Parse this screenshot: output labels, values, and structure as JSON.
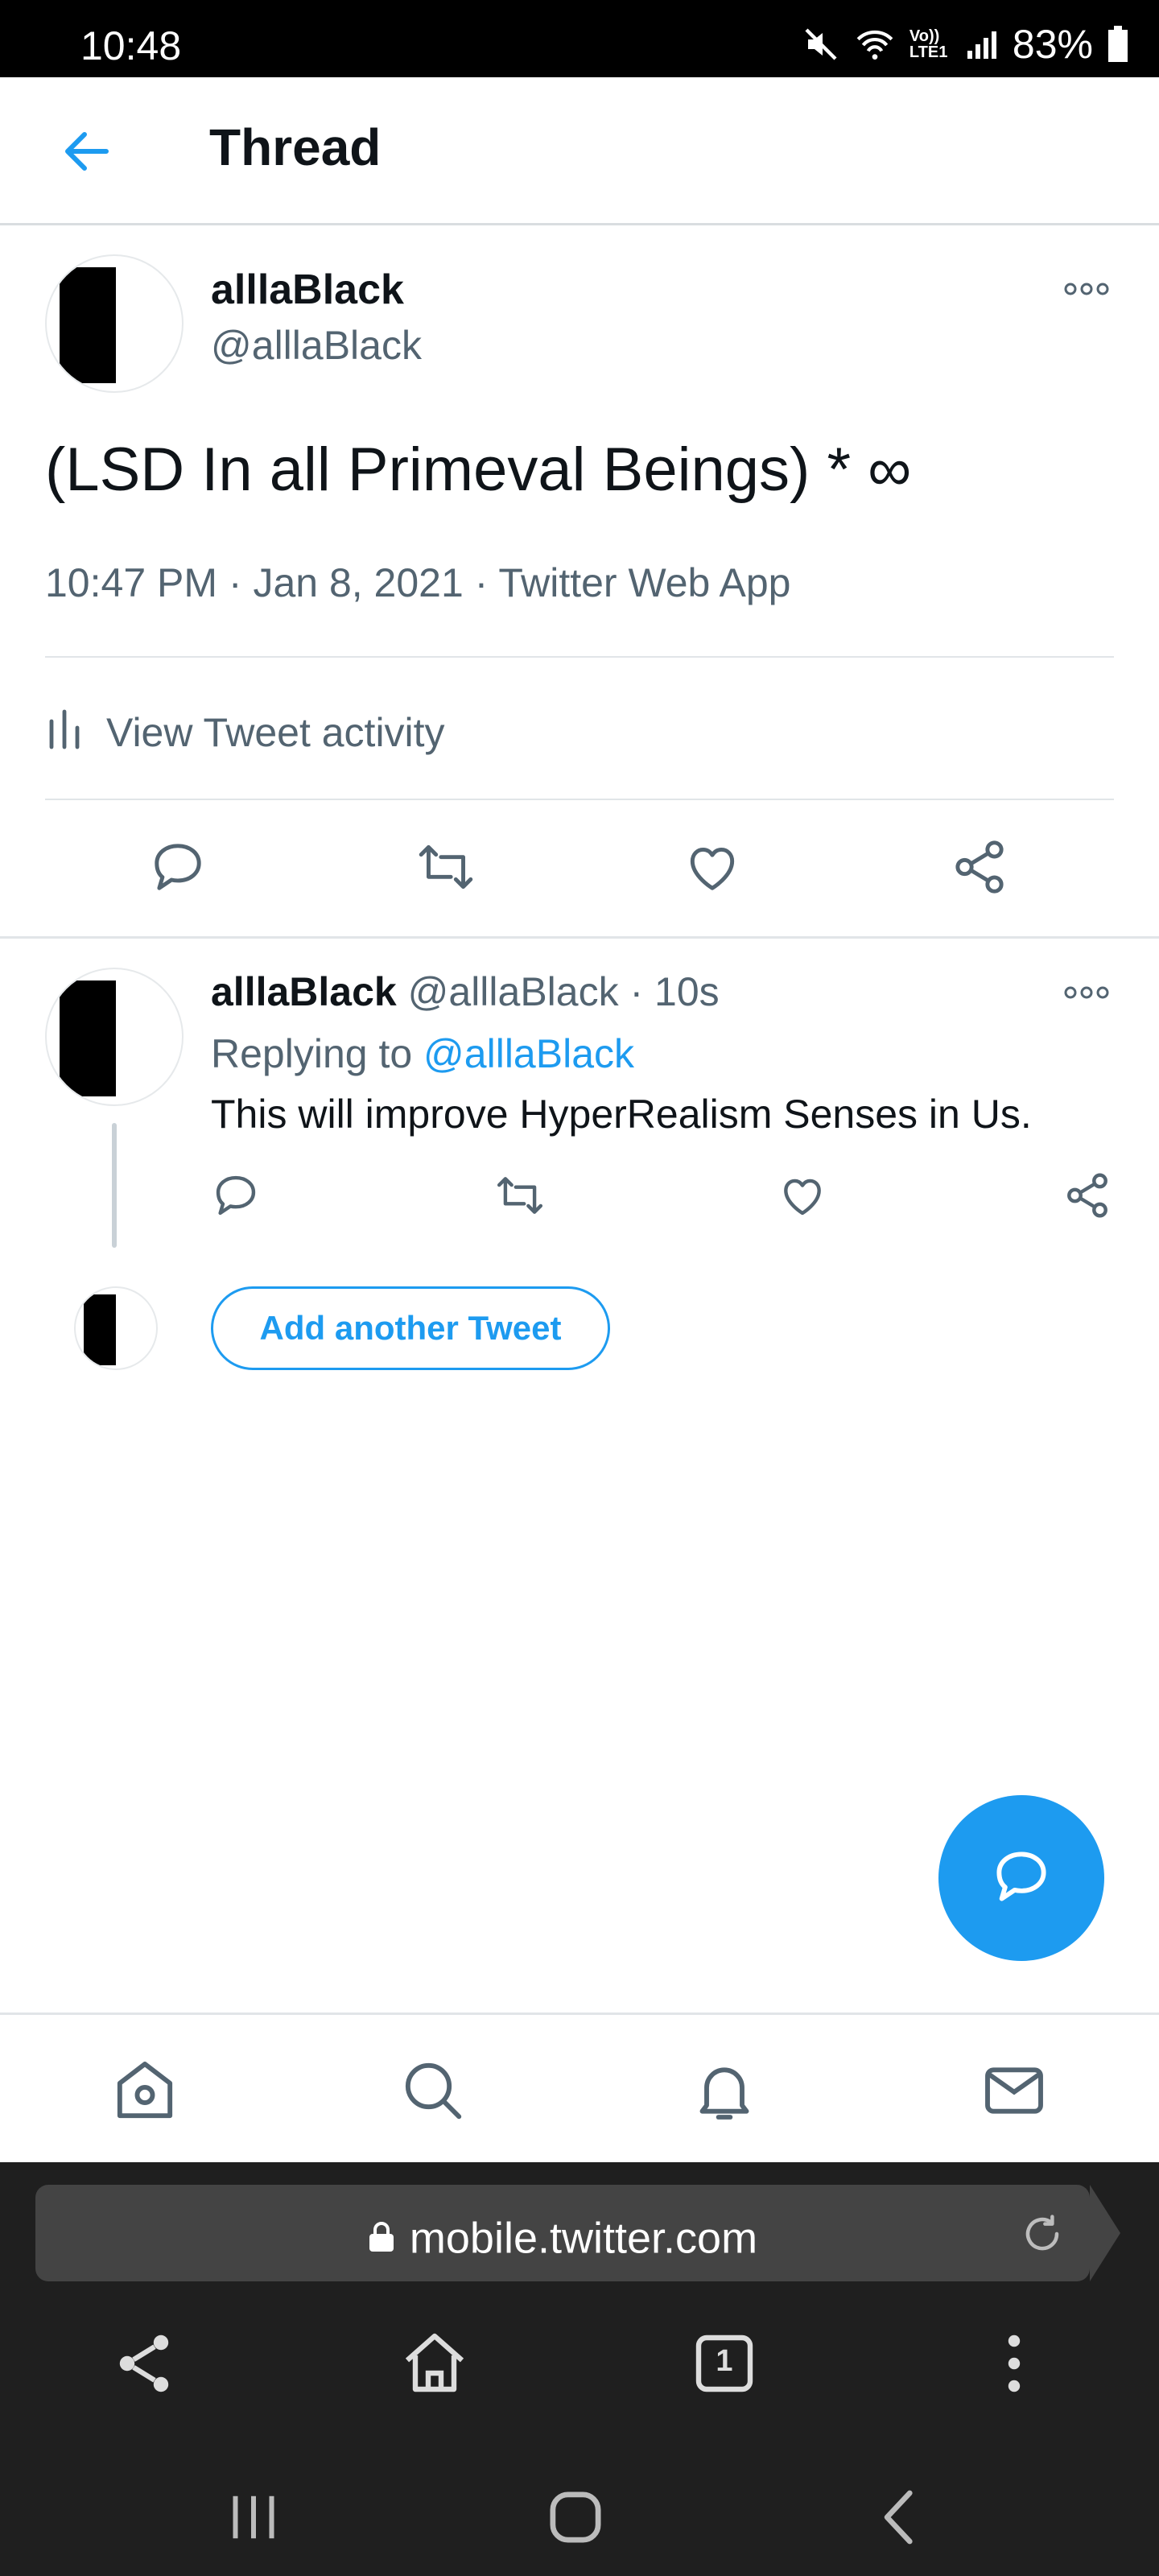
{
  "status_bar": {
    "time": "10:48",
    "network_label": "Vo)) LTE1",
    "battery": "83%"
  },
  "header": {
    "title": "Thread"
  },
  "main_tweet": {
    "display_name": "alllaBlack",
    "handle": "@alllaBlack",
    "text": "(LSD In all Primeval Beings) * ∞",
    "time": "10:47 PM",
    "date": "Jan 8, 2021",
    "source": "Twitter Web App",
    "meta_separator": " · ",
    "activity_label": "View Tweet activity"
  },
  "reply_tweet": {
    "display_name": "alllaBlack",
    "handle": "@alllaBlack",
    "separator": " · ",
    "time": "10s",
    "replying_prefix": "Replying to ",
    "replying_to": "@alllaBlack",
    "text": "This will improve HyperRealism Senses in Us."
  },
  "compose": {
    "add_label": "Add another Tweet"
  },
  "browser": {
    "url": "mobile.twitter.com",
    "tabs_count": "1"
  },
  "colors": {
    "accent": "#1d9bf0",
    "muted": "#536471",
    "text": "#0f1419",
    "browser_bg": "#1f1f1f"
  },
  "icons": {
    "nav": [
      "home-icon",
      "search-icon",
      "notifications-icon",
      "messages-icon"
    ],
    "tweet_actions": [
      "reply-icon",
      "retweet-icon",
      "like-icon",
      "share-icon"
    ]
  }
}
